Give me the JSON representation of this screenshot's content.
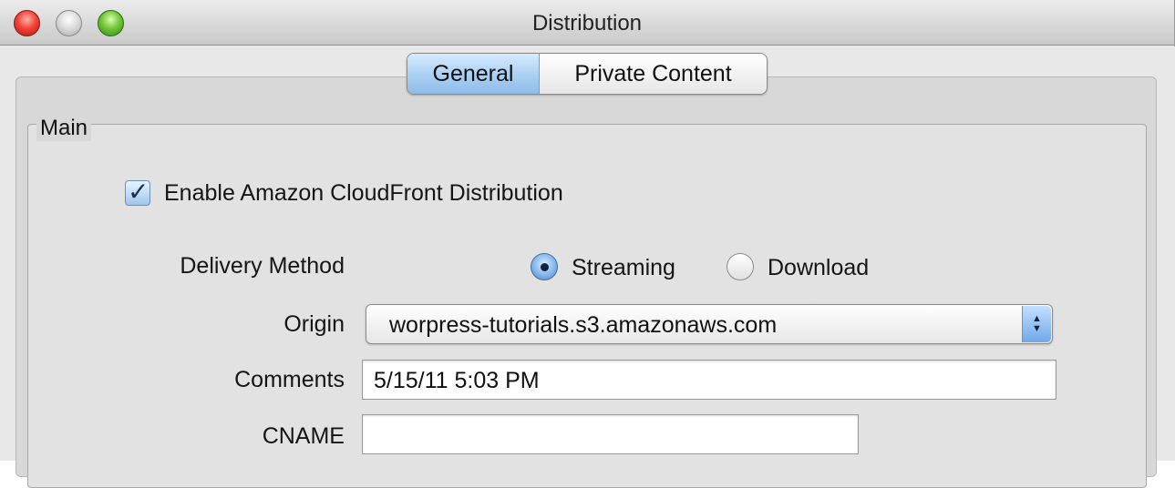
{
  "window": {
    "title": "Distribution"
  },
  "tabs": [
    {
      "label": "General",
      "selected": true
    },
    {
      "label": "Private Content",
      "selected": false
    }
  ],
  "main": {
    "legend": "Main",
    "enable_checkbox": {
      "label": "Enable Amazon CloudFront Distribution",
      "checked": true
    },
    "delivery": {
      "label": "Delivery Method",
      "options": [
        {
          "label": "Streaming",
          "selected": true
        },
        {
          "label": "Download",
          "selected": false
        }
      ]
    },
    "origin": {
      "label": "Origin",
      "value": "worpress-tutorials.s3.amazonaws.com"
    },
    "comments": {
      "label": "Comments",
      "value": "5/15/11 5:03 PM"
    },
    "cname": {
      "label": "CNAME",
      "value": ""
    }
  },
  "icons": {
    "checkmark": "checkmark-icon",
    "select_arrows": "updown-arrows-icon"
  }
}
